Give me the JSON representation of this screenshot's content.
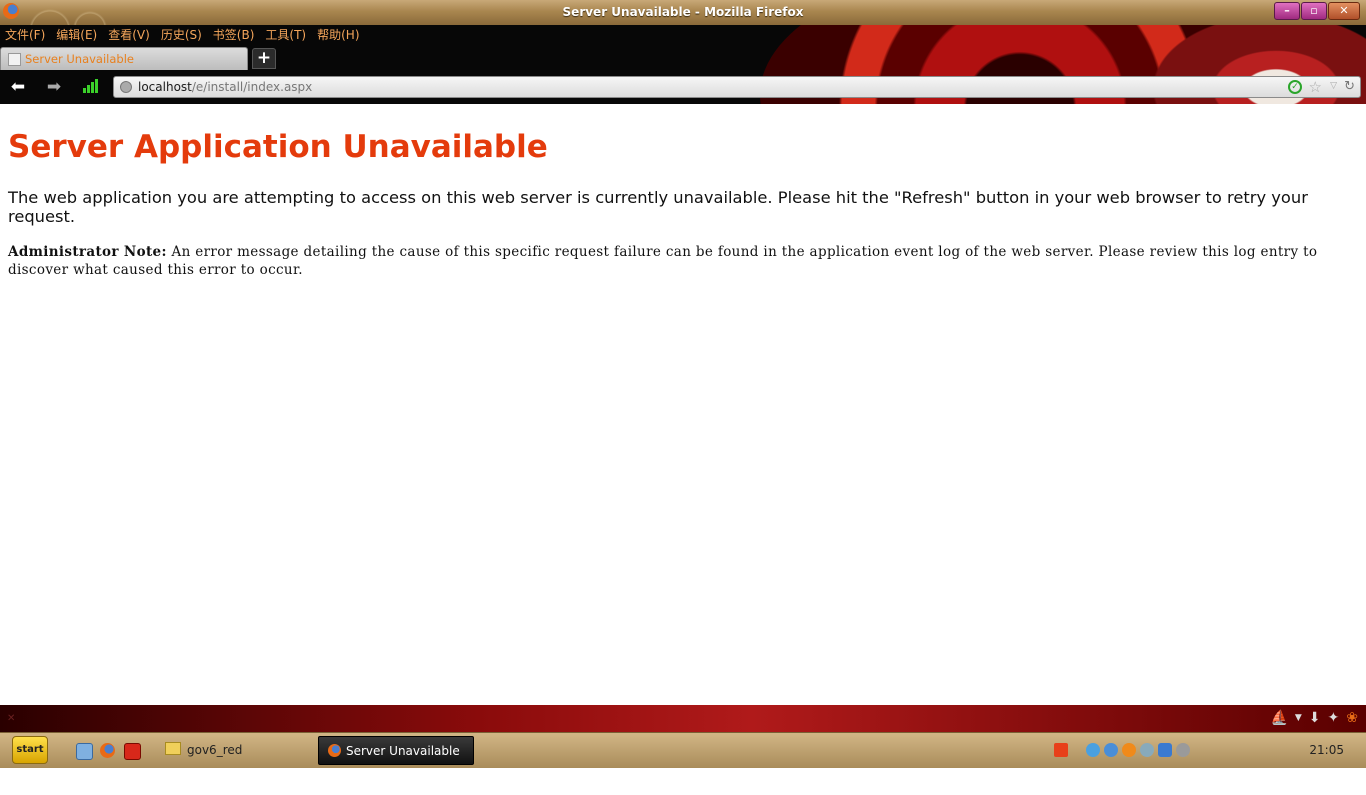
{
  "window": {
    "title": "Server Unavailable - Mozilla Firefox",
    "controls": {
      "minimize": "–",
      "restore": "▫",
      "close": "✕"
    }
  },
  "menu": [
    {
      "label": "文件(F)"
    },
    {
      "label": "编辑(E)"
    },
    {
      "label": "查看(V)"
    },
    {
      "label": "历史(S)"
    },
    {
      "label": "书签(B)"
    },
    {
      "label": "工具(T)"
    },
    {
      "label": "帮助(H)"
    }
  ],
  "tabs": [
    {
      "title": "Server Unavailable",
      "active": true
    }
  ],
  "newtab_label": "+",
  "nav": {
    "back_icon": "arrow-left",
    "forward_icon": "arrow-right",
    "url_host": "localhost",
    "url_path": "/e/install/index.aspx",
    "reload_icon": "reload"
  },
  "page": {
    "heading": "Server Application Unavailable",
    "paragraph": "The web application you are attempting to access on this web server is currently unavailable.  Please hit the \"Refresh\" button in your web browser to retry your request.",
    "note_label": "Administrator Note:",
    "note_text": " An error message detailing the cause of this specific request failure can be found in the application event log of the web server. Please review this log entry to discover what caused this error to occur."
  },
  "colors": {
    "heading": "#e43b0c",
    "menu_text": "#f5a65b",
    "tab_text": "#e8801e"
  },
  "taskbar": {
    "start_label": "start",
    "tasks": [
      {
        "label": "gov6_red"
      },
      {
        "label": "Server Unavailable -..."
      }
    ],
    "clock": "21:05"
  }
}
